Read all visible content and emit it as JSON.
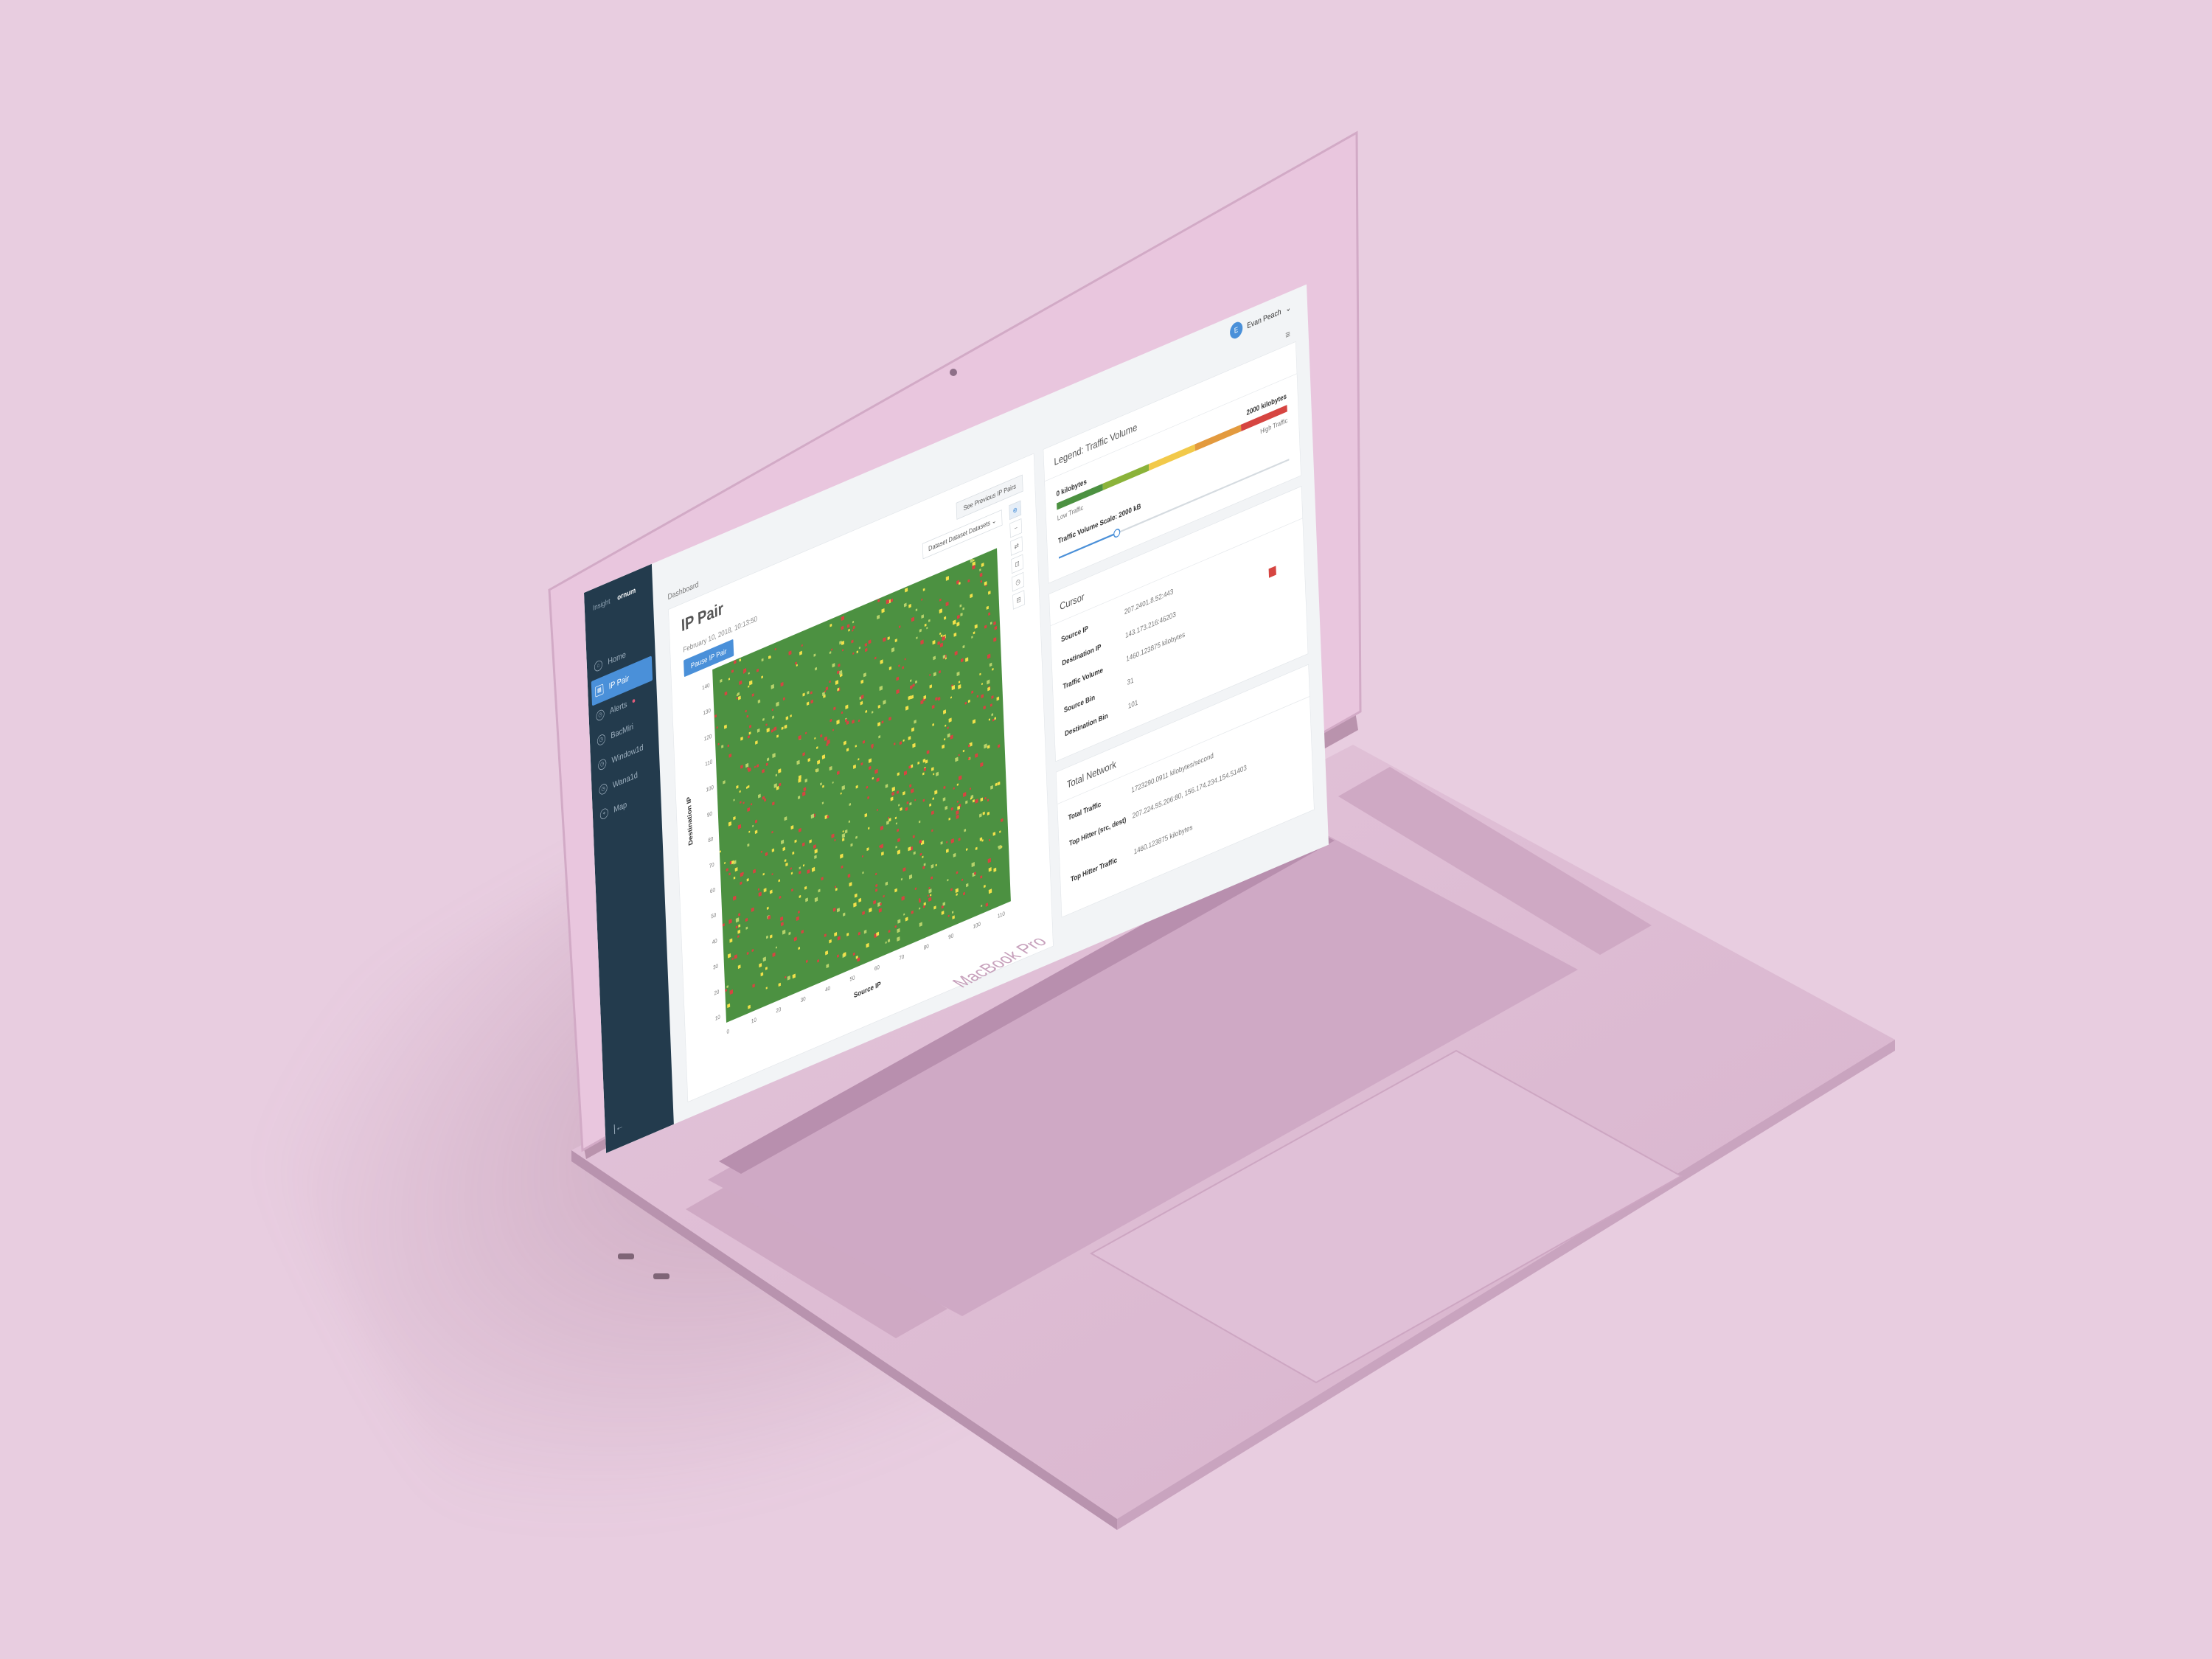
{
  "device": {
    "model_label": "MacBook Pro",
    "colors": {
      "background": "#e8cde0",
      "body": "#dcb8d2",
      "bezel": "#e9c6de"
    }
  },
  "sidebar": {
    "brand": [
      "Insight",
      "ornum"
    ],
    "items": [
      {
        "label": "Home",
        "icon": "home-icon",
        "active": false
      },
      {
        "label": "IP Pair",
        "icon": "grid-icon",
        "active": true
      },
      {
        "label": "Alerts",
        "icon": "clock-icon",
        "active": false,
        "badge": true
      },
      {
        "label": "BacMiri",
        "icon": "clock-icon",
        "active": false
      },
      {
        "label": "Window1d",
        "icon": "clock-icon",
        "active": false
      },
      {
        "label": "Wana1d",
        "icon": "clock-icon",
        "active": false
      },
      {
        "label": "Map",
        "icon": "map-pin-icon",
        "active": false
      }
    ],
    "collapse_glyph": "|←"
  },
  "topbar": {
    "user_initial": "E",
    "user_name": "Evan Peach",
    "dropdown_glyph": "⌄"
  },
  "breadcrumb": "Dashboard",
  "main": {
    "title": "IP Pair",
    "timestamp": "February 10, 2018, 10:13:50",
    "pause_label": "Pause IP Pair",
    "previous_label": "See Previous IP Pairs",
    "dataset": "Dataset Dataset Datasets ⌄",
    "tools": [
      "⊕",
      "−",
      "⇄",
      "⊡",
      "◷",
      "⊟"
    ],
    "y_axis_label": "Destination IP",
    "x_axis_label": "Source IP",
    "y_ticks": [
      "140",
      "130",
      "120",
      "110",
      "100",
      "90",
      "80",
      "70",
      "60",
      "50",
      "40",
      "30",
      "20",
      "10"
    ],
    "x_ticks": [
      "0",
      "10",
      "20",
      "30",
      "40",
      "50",
      "60",
      "70",
      "80",
      "90",
      "100",
      "110"
    ]
  },
  "chart_data": {
    "type": "heatmap",
    "xlabel": "Source IP",
    "ylabel": "Destination IP",
    "colors": {
      "low": "#4c9141",
      "mid": "#f2e14a",
      "high": "#d64541"
    }
  },
  "legend": {
    "title": "Legend: Traffic Volume",
    "low_value": "0 kilobytes",
    "high_value": "2000 kilobytes",
    "low_label": "Low Traffic",
    "high_label": "High Traffic",
    "scale_label": "Traffic Volume Scale: 2000 kB",
    "gradient": [
      "#4c9141",
      "#8bb33a",
      "#f2c94a",
      "#e39a3e",
      "#d64541"
    ],
    "slider_fraction": 0.25
  },
  "cursor": {
    "title": "Cursor",
    "rows": [
      {
        "key": "Source IP",
        "value": "207.2401.8.52:443"
      },
      {
        "key": "Destination IP",
        "value": "143.173.216:46203"
      },
      {
        "key": "Traffic Volume",
        "value": "1460.123875 kilobytes"
      },
      {
        "key": "Source Bin",
        "value": "31"
      },
      {
        "key": "Destination Bin",
        "value": "101"
      }
    ]
  },
  "network": {
    "title": "Total Network",
    "rows": [
      {
        "key": "Total Traffic",
        "value": "1723290.0911 kilobytes/second"
      },
      {
        "key": "Top Hitter (src, dest)",
        "value": "207.224.55.206:80, 156.174.234.154.51403"
      },
      {
        "key": "Top Hitter Traffic",
        "value": "1460.123875 kilobytes"
      }
    ]
  }
}
